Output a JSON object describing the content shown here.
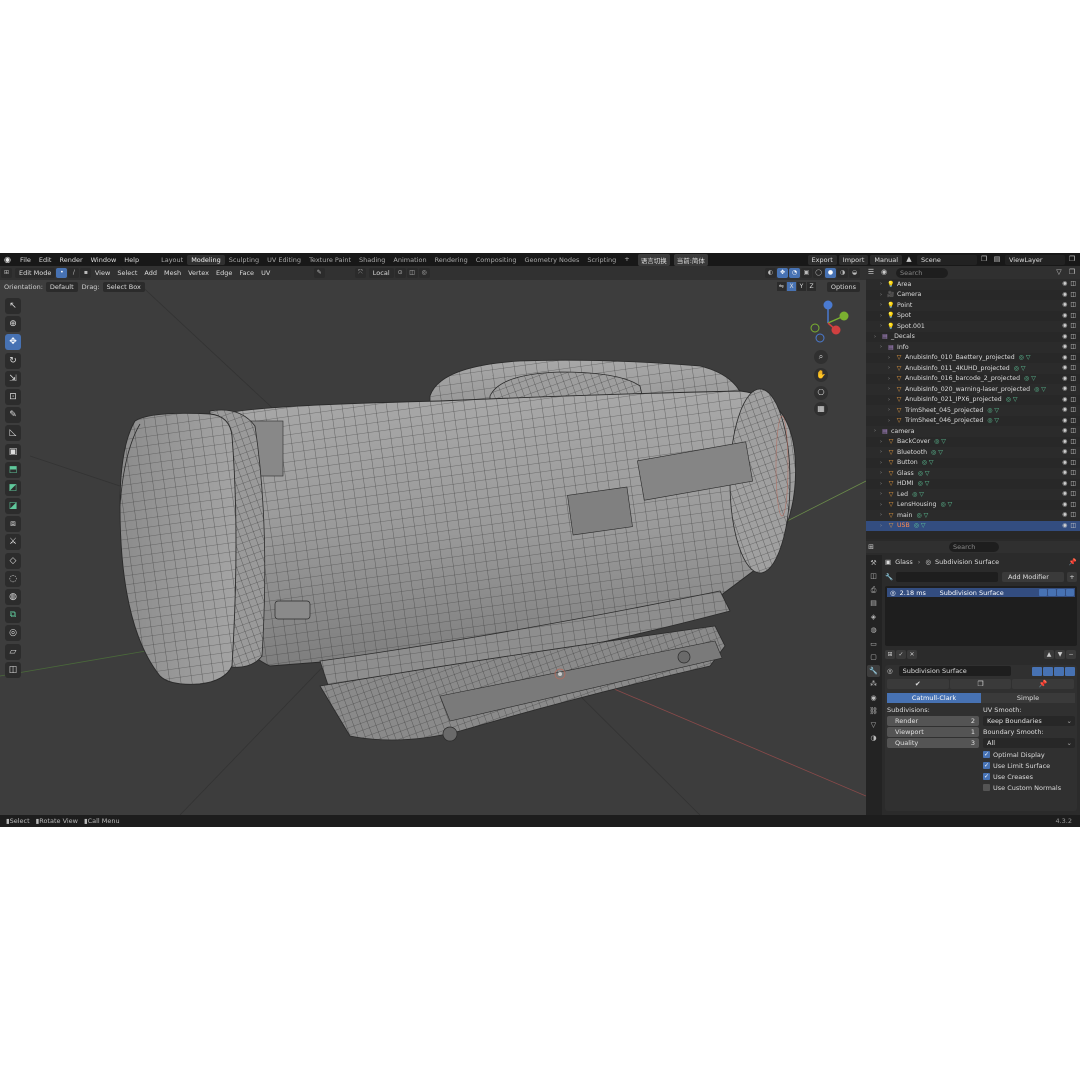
{
  "menu": [
    "File",
    "Edit",
    "Render",
    "Window",
    "Help"
  ],
  "workspaces": [
    "Layout",
    "Modeling",
    "Sculpting",
    "UV Editing",
    "Texture Paint",
    "Shading",
    "Animation",
    "Rendering",
    "Compositing",
    "Geometry Nodes",
    "Scripting"
  ],
  "active_workspace": "Modeling",
  "ime_left": "语言切换",
  "ime_right": "当前:简体",
  "top_right": {
    "export": "Export",
    "import": "Import",
    "manual": "Manual",
    "scene": "Scene",
    "view_layer": "ViewLayer"
  },
  "viewport_header": {
    "mode": "Edit Mode",
    "menus": [
      "View",
      "Select",
      "Add",
      "Mesh",
      "Vertex",
      "Edge",
      "Face",
      "UV"
    ],
    "transform_space": "Local",
    "orientation_label": "Orientation:",
    "orientation_value": "Default",
    "drag_label": "Drag:",
    "drag_value": "Select Box",
    "axes": [
      "X",
      "Y",
      "Z"
    ],
    "options": "Options"
  },
  "outliner": {
    "search_placeholder": "Search",
    "rows": [
      {
        "name": "Area",
        "icon": "light-icon"
      },
      {
        "name": "Camera",
        "icon": "camera-icon"
      },
      {
        "name": "Point",
        "icon": "light-icon"
      },
      {
        "name": "Spot",
        "icon": "light-icon"
      },
      {
        "name": "Spot.001",
        "icon": "light-icon"
      },
      {
        "name": "_Decals",
        "icon": "collection-icon"
      },
      {
        "name": "Info",
        "icon": "collection-icon"
      },
      {
        "name": "AnubisInfo_010_Baettery_projected",
        "icon": "mesh-icon"
      },
      {
        "name": "AnubisInfo_011_4KUHD_projected",
        "icon": "mesh-icon"
      },
      {
        "name": "AnubisInfo_016_barcode_2_projected",
        "icon": "mesh-icon"
      },
      {
        "name": "AnubisInfo_020_warning-laser_projected",
        "icon": "mesh-icon"
      },
      {
        "name": "AnubisInfo_021_IPX6_projected",
        "icon": "mesh-icon"
      },
      {
        "name": "TrimSheet_045_projected",
        "icon": "mesh-icon"
      },
      {
        "name": "TrimSheet_046_projected",
        "icon": "mesh-icon"
      },
      {
        "name": "camera",
        "icon": "collection-icon"
      },
      {
        "name": "BackCover",
        "icon": "mesh-icon"
      },
      {
        "name": "Bluetooth",
        "icon": "mesh-icon"
      },
      {
        "name": "Button",
        "icon": "mesh-icon"
      },
      {
        "name": "Glass",
        "icon": "mesh-icon"
      },
      {
        "name": "HDMI",
        "icon": "mesh-icon"
      },
      {
        "name": "Led",
        "icon": "mesh-icon"
      },
      {
        "name": "LensHousing",
        "icon": "mesh-icon"
      },
      {
        "name": "main",
        "icon": "mesh-icon"
      },
      {
        "name": "USB",
        "icon": "mesh-icon"
      }
    ]
  },
  "properties": {
    "search_placeholder": "Search",
    "object": "Glass",
    "modifier_crumb": "Subdivision Surface",
    "add_modifier": "Add Modifier",
    "stack_time": "2.18 ms",
    "stack_name": "Subdivision Surface",
    "modifier_name": "Subdivision Surface",
    "algo_catmull": "Catmull-Clark",
    "algo_simple": "Simple",
    "subdivisions_label": "Subdivisions:",
    "render_label": "Render",
    "render_value": "2",
    "viewport_label": "Viewport",
    "viewport_value": "1",
    "quality_label": "Quality",
    "quality_value": "3",
    "uv_smooth_label": "UV Smooth:",
    "uv_smooth_value": "Keep Boundaries",
    "boundary_smooth_label": "Boundary Smooth:",
    "boundary_smooth_value": "All",
    "optimal_display": "Optimal Display",
    "use_limit_surface": "Use Limit Surface",
    "use_creases": "Use Creases",
    "use_custom_normals": "Use Custom Normals",
    "checks": [
      true,
      true,
      true,
      false
    ]
  },
  "statusbar": {
    "select": "Select",
    "rotate": "Rotate View",
    "call_menu": "Call Menu",
    "version": "4.3.2"
  },
  "colors": {
    "accent": "#4772b3",
    "selected_row": "#334d80",
    "viewport_bg": "#3d3d3d",
    "mesh": "#9a9a9a",
    "wire": "#2a2a2a"
  }
}
